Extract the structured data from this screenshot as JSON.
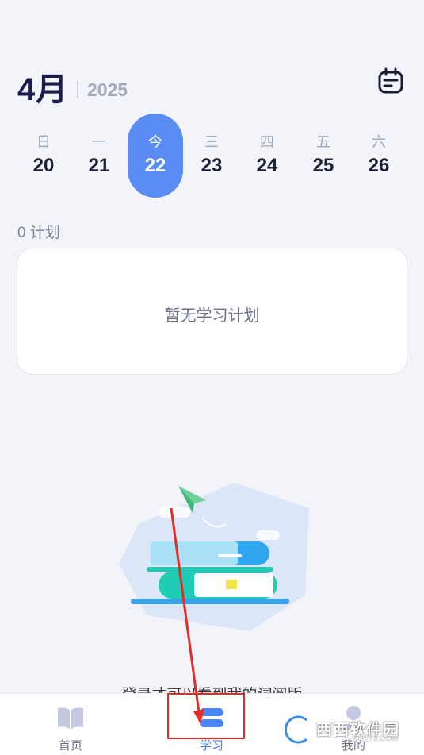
{
  "header": {
    "month": "4月",
    "year": "2025"
  },
  "week": [
    {
      "weekday": "日",
      "day": "20",
      "today": false
    },
    {
      "weekday": "一",
      "day": "21",
      "today": false
    },
    {
      "weekday": "今",
      "day": "22",
      "today": true
    },
    {
      "weekday": "三",
      "day": "23",
      "today": false
    },
    {
      "weekday": "四",
      "day": "24",
      "today": false
    },
    {
      "weekday": "五",
      "day": "25",
      "today": false
    },
    {
      "weekday": "六",
      "day": "26",
      "today": false
    }
  ],
  "plans": {
    "count_label": "0 计划",
    "empty_text": "暂无学习计划"
  },
  "login_hint": "登录才可以看到我的词阅版",
  "tabbar": {
    "home": "首页",
    "study": "学习",
    "mine": "我的"
  },
  "watermark": {
    "text": "西西软件园",
    "sub": "CR173.COM"
  },
  "colors": {
    "accent": "#5b8cf6",
    "active_tab": "#3c7ef5",
    "annotation": "#e52b25"
  },
  "icons": {
    "calendar": "calendar-icon",
    "home": "book-icon",
    "study": "study-icon",
    "mine": "avatar-icon"
  }
}
